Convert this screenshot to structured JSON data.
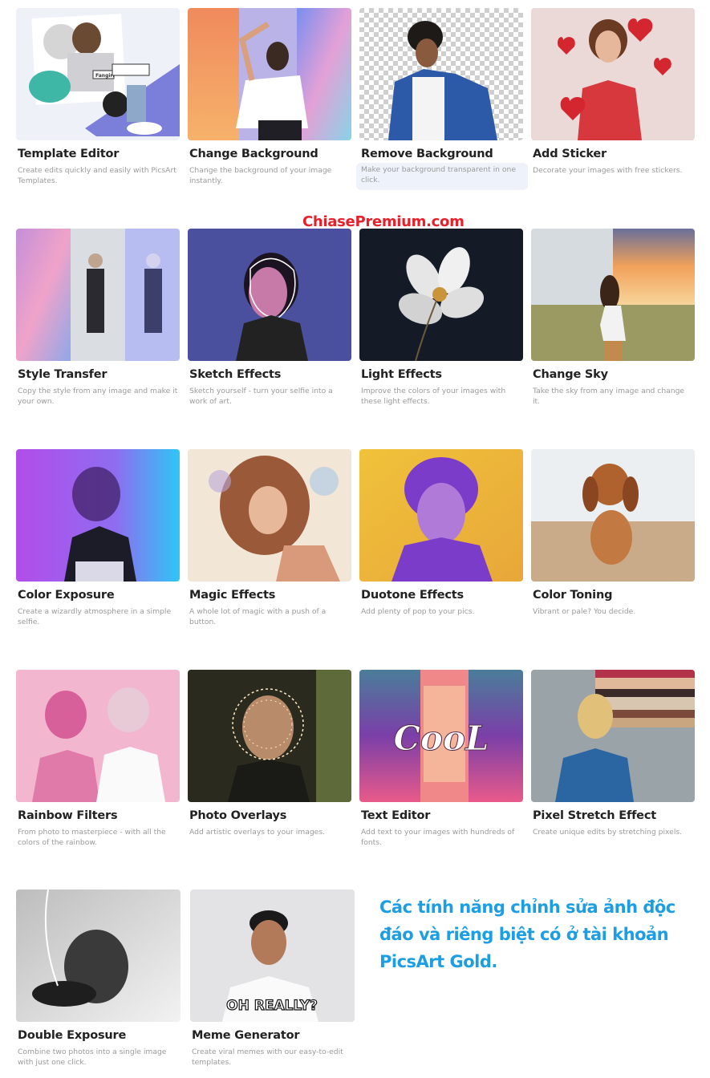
{
  "features": [
    {
      "title": "Template Editor",
      "description": "Create edits quickly and easily with PicsArt Templates.",
      "thumbnail": "template-collage-image"
    },
    {
      "title": "Change Background",
      "description": "Change the background of your image instantly.",
      "thumbnail": "woman-colorful-background-image"
    },
    {
      "title": "Remove Background",
      "description": "Make your background transparent in one click.",
      "thumbnail": "man-transparent-background-image"
    },
    {
      "title": "Add Sticker",
      "description": "Decorate your images with free stickers.",
      "thumbnail": "woman-heart-stickers-image"
    },
    {
      "title": "Style Transfer",
      "description": "Copy the style from any image and make it your own.",
      "thumbnail": "style-transfer-snow-image"
    },
    {
      "title": "Sketch Effects",
      "description": "Sketch yourself - turn your selfie into a work of art.",
      "thumbnail": "sketch-face-image"
    },
    {
      "title": "Light Effects",
      "description": "Improve the colors of your images with these light effects.",
      "thumbnail": "white-flower-image"
    },
    {
      "title": "Change Sky",
      "description": "Take the sky from any image and change it.",
      "thumbnail": "woman-field-sunset-image"
    },
    {
      "title": "Color Exposure",
      "description": "Create a wizardly atmosphere in a simple selfie.",
      "thumbnail": "color-exposure-image"
    },
    {
      "title": "Magic Effects",
      "description": "A whole lot of magic with a push of a button.",
      "thumbnail": "painted-curly-hair-image"
    },
    {
      "title": "Duotone Effects",
      "description": "Add plenty of pop to your pics.",
      "thumbnail": "duotone-portrait-image"
    },
    {
      "title": "Color Toning",
      "description": "Vibrant or pale? You decide.",
      "thumbnail": "dog-beach-image"
    },
    {
      "title": "Rainbow Filters",
      "description": "From photo to masterpiece - with all the colors of the rainbow.",
      "thumbnail": "pink-couple-image"
    },
    {
      "title": "Photo Overlays",
      "description": "Add artistic overlays to your images.",
      "thumbnail": "light-overlay-portrait-image"
    },
    {
      "title": "Text Editor",
      "description": "Add text to your images with hundreds of fonts.",
      "thumbnail": "cool-text-hallway-image",
      "overlay_text": "CooL"
    },
    {
      "title": "Pixel Stretch Effect",
      "description": "Create unique edits by stretching pixels.",
      "thumbnail": "pixel-stretch-portrait-image"
    },
    {
      "title": "Double Exposure",
      "description": "Combine two photos into a single image with just one click.",
      "thumbnail": "double-exposure-bw-image"
    },
    {
      "title": "Meme Generator",
      "description": "Create viral memes with our easy-to-edit templates.",
      "thumbnail": "surprised-man-meme-image",
      "overlay_text": "OH REALLY?"
    }
  ],
  "template_sticker_text": "Fangirl",
  "watermark": "ChiasePremium.com",
  "promo_text": "Các tính năng chỉnh sửa ảnh độc đáo và riêng biệt có ở tài khoản PicsArt Gold.",
  "colors": {
    "watermark": "#e8202a",
    "promo": "#1c9ee4",
    "title": "#222222",
    "description": "#9a9a9a",
    "highlight": "#eef2fb"
  }
}
